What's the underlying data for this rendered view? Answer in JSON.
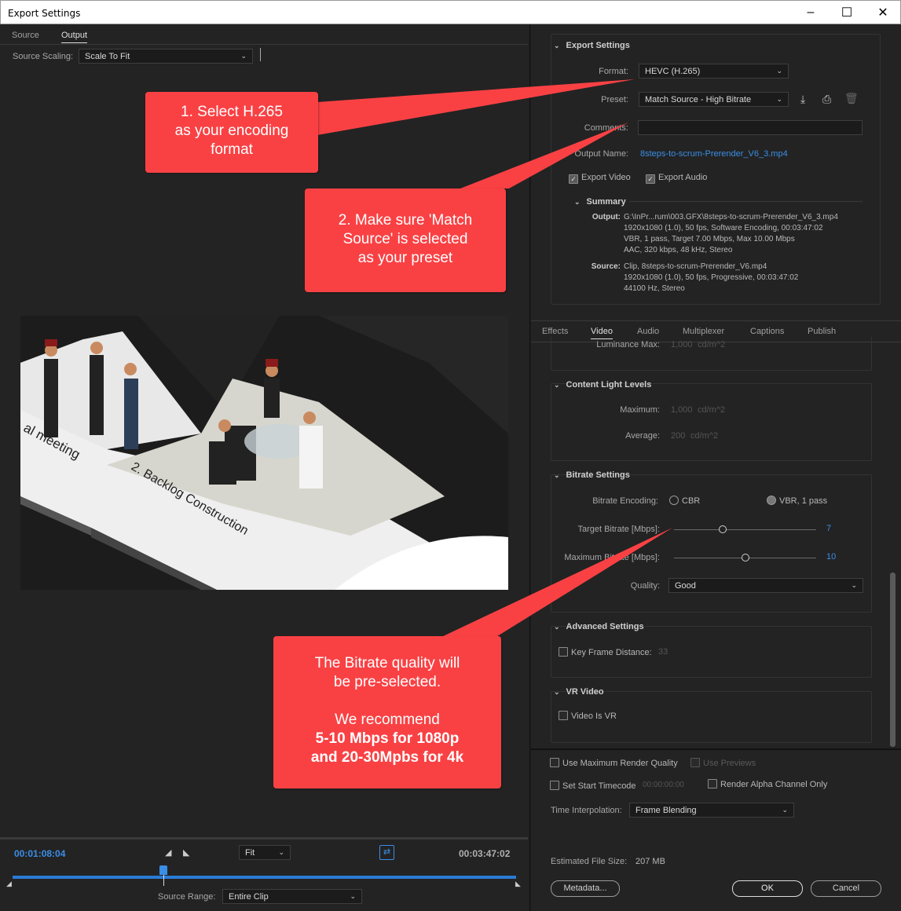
{
  "window": {
    "title": "Export Settings"
  },
  "left": {
    "tabs": [
      "Source",
      "Output"
    ],
    "source_scaling_label": "Source Scaling:",
    "source_scaling_value": "Scale To Fit",
    "timecode_start": "00:01:08:04",
    "timecode_end": "00:03:47:02",
    "fit_value": "Fit",
    "source_range_label": "Source Range:",
    "source_range_value": "Entire Clip",
    "playhead_fraction": 0.3
  },
  "preview": {
    "text1": "al meeting",
    "text2": "2. Backlog Construction"
  },
  "export_settings": {
    "header": "Export Settings",
    "format_label": "Format:",
    "format_value": "HEVC (H.265)",
    "preset_label": "Preset:",
    "preset_value": "Match Source - High Bitrate",
    "comments_label": "Comments:",
    "output_name_label": "Output Name:",
    "output_name_value": "8steps-to-scrum-Prerender_V6_3.mp4",
    "export_video": "Export Video",
    "export_audio": "Export Audio",
    "summary_header": "Summary",
    "output_key": "Output:",
    "output_lines": [
      "G:\\InPr...rum\\003.GFX\\8steps-to-scrum-Prerender_V6_3.mp4",
      "1920x1080 (1.0), 50 fps, Software Encoding, 00:03:47:02",
      "VBR, 1 pass, Target 7.00 Mbps, Max 10.00 Mbps",
      "AAC, 320 kbps, 48 kHz, Stereo"
    ],
    "source_key": "Source:",
    "source_lines": [
      "Clip, 8steps-to-scrum-Prerender_V6.mp4",
      "1920x1080 (1.0), 50 fps, Progressive, 00:03:47:02",
      "44100 Hz, Stereo"
    ]
  },
  "settings_tabs": [
    "Effects",
    "Video",
    "Audio",
    "Multiplexer",
    "Captions",
    "Publish"
  ],
  "video": {
    "luminance_max_label": "Luminance Max:",
    "luminance_max_value": "1,000",
    "luminance_unit": "cd/m^2",
    "content_light_header": "Content Light Levels",
    "maximum_label": "Maximum:",
    "maximum_value": "1,000",
    "average_label": "Average:",
    "average_value": "200",
    "bitrate_header": "Bitrate Settings",
    "bitrate_encoding_label": "Bitrate Encoding:",
    "cbr": "CBR",
    "vbr": "VBR, 1 pass",
    "target_label": "Target Bitrate [Mbps]:",
    "target_value": "7",
    "target_fraction": 0.34,
    "max_label": "Maximum Bitrate [Mbps]:",
    "max_value": "10",
    "max_fraction": 0.5,
    "quality_label": "Quality:",
    "quality_value": "Good",
    "advanced_header": "Advanced Settings",
    "key_frame_label": "Key Frame Distance:",
    "key_frame_value": "33",
    "vr_header": "VR Video",
    "vr_label": "Video Is VR"
  },
  "bottom": {
    "use_max_render": "Use Maximum Render Quality",
    "use_previews": "Use Previews",
    "set_start_tc": "Set Start Timecode",
    "start_tc_value": "00:00:00:00",
    "render_alpha": "Render Alpha Channel Only",
    "time_interp_label": "Time Interpolation:",
    "time_interp_value": "Frame Blending",
    "file_size_label": "Estimated File Size:",
    "file_size_value": "207 MB",
    "metadata_btn": "Metadata...",
    "ok_btn": "OK",
    "cancel_btn": "Cancel"
  },
  "callouts": {
    "c1": [
      "1. Select H.265",
      "as your encoding",
      "format"
    ],
    "c2": [
      "2. Make sure 'Match",
      "Source' is selected",
      "as your preset"
    ],
    "c3_lines": [
      "The Bitrate quality will",
      "be pre-selected.",
      "",
      "We recommend"
    ],
    "c3_bold": [
      "5-10 Mbps for 1080p",
      "and 20-30Mpbs for 4k"
    ]
  },
  "colors": {
    "callout": "#f94144",
    "accent": "#3a8ee6"
  }
}
